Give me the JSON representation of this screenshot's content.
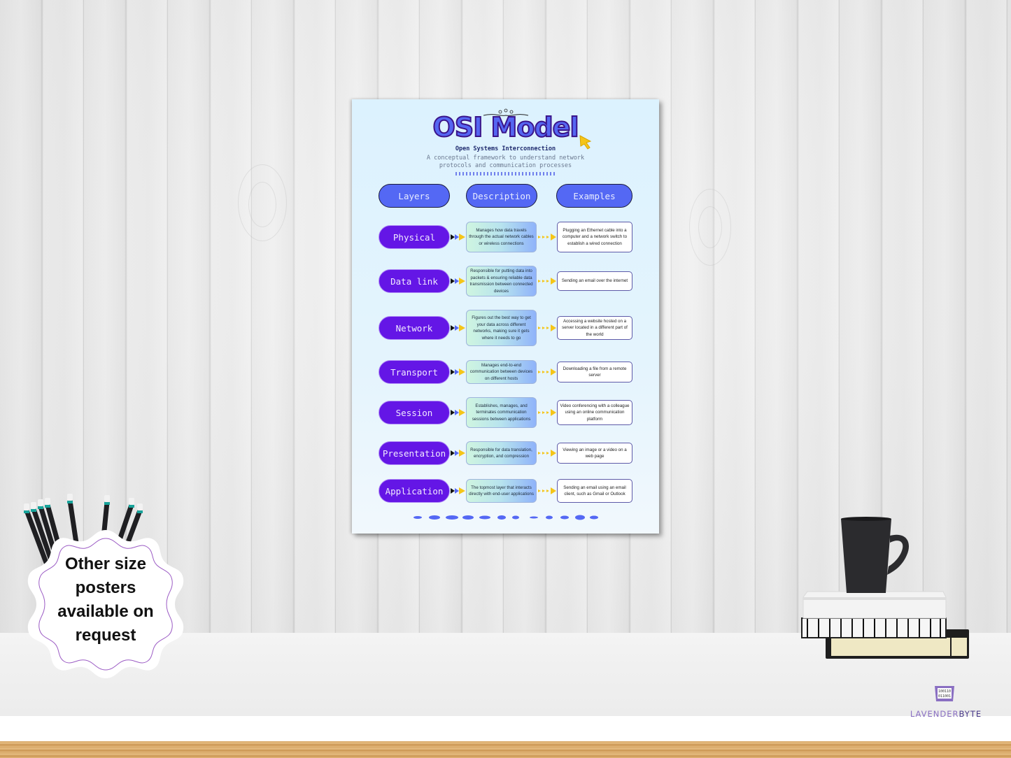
{
  "scene": {
    "description": "Mockup of an OSI Model poster hanging on a white wood-panel wall above a desk",
    "badge": {
      "lines": [
        "Other size",
        "posters",
        "available on",
        "request"
      ]
    },
    "logo": {
      "icon_bits": [
        "100110",
        "011001"
      ],
      "brand_part1": "LAVENDER",
      "brand_part2": "BYTE"
    }
  },
  "poster": {
    "title": "OSI Model",
    "subtitle": "Open Systems Interconnection",
    "tagline_line1": "A conceptual framework to understand network",
    "tagline_line2": "protocols and communication processes",
    "headers": {
      "layers": "Layers",
      "description": "Description",
      "examples": "Examples"
    },
    "colors": {
      "header_pill": "#5468f4",
      "layer_pill": "#6416e6",
      "arrow_yellow": "#f5c518",
      "title_fill": "#5566f2",
      "title_outline": "#3a148a"
    },
    "layers": [
      {
        "name": "Physical",
        "description": "Manages how data travels through the actual network cables or wireless connections",
        "example": "Plugging an Ethernet cable into a computer and a network switch to establish a wired connection"
      },
      {
        "name": "Data link",
        "description": "Responsible for putting data into packets & ensuring reliable data transmission between connected devices",
        "example": "Sending an email over the internet"
      },
      {
        "name": "Network",
        "description": "Figures out the best way to get your data across different networks, making sure it gets where it needs to go",
        "example": "Accessing a website hosted on a server located in a different part of the world"
      },
      {
        "name": "Transport",
        "description": "Manages end-to-end communication between devices on different hosts",
        "example": "Downloading a file from a remote server"
      },
      {
        "name": "Session",
        "description": "Establishes, manages, and terminates communication sessions between applications",
        "example": "Video conferencing with a colleague using an online communication platform"
      },
      {
        "name": "Presentation",
        "description": "Responsible for data translation, encryption, and compression",
        "example": "Viewing an image or a video on a web page"
      },
      {
        "name": "Application",
        "description": "The topmost layer that interacts directly with end-user applications",
        "example": "Sending an email using an email client, such as Gmail or Outlook"
      }
    ]
  }
}
